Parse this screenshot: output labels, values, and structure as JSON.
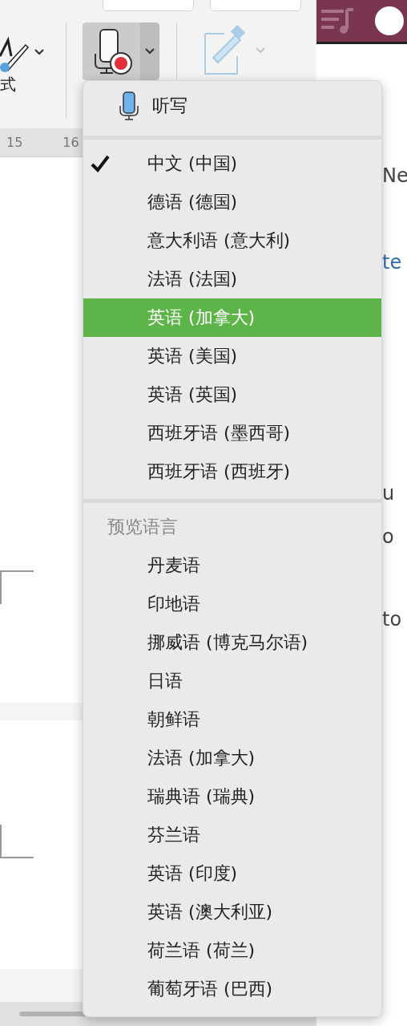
{
  "toolbar": {
    "styles_label": "式"
  },
  "ruler": {
    "marks": [
      "15",
      "16"
    ]
  },
  "side_panel": {
    "texts": [
      {
        "text": "Ne",
        "kind": "text"
      },
      {
        "text": "te",
        "kind": "link"
      },
      {
        "text": "u",
        "kind": "text"
      },
      {
        "text": "o",
        "kind": "text"
      },
      {
        "text": "to",
        "kind": "text"
      }
    ]
  },
  "menu": {
    "header": {
      "label": "听写"
    },
    "languages": [
      {
        "label": "中文 (中国)",
        "checked": true,
        "selected": false
      },
      {
        "label": "德语 (德国)",
        "checked": false,
        "selected": false
      },
      {
        "label": "意大利语 (意大利)",
        "checked": false,
        "selected": false
      },
      {
        "label": "法语 (法国)",
        "checked": false,
        "selected": false
      },
      {
        "label": "英语 (加拿大)",
        "checked": false,
        "selected": true
      },
      {
        "label": "英语 (美国)",
        "checked": false,
        "selected": false
      },
      {
        "label": "英语 (英国)",
        "checked": false,
        "selected": false
      },
      {
        "label": "西班牙语 (墨西哥)",
        "checked": false,
        "selected": false
      },
      {
        "label": "西班牙语 (西班牙)",
        "checked": false,
        "selected": false
      }
    ],
    "preview_section": {
      "title": "预览语言",
      "items": [
        {
          "label": "丹麦语",
          "selected": false
        },
        {
          "label": "印地语",
          "selected": false
        },
        {
          "label": "挪威语 (博克马尔语)",
          "selected": false
        },
        {
          "label": "日语",
          "selected": false
        },
        {
          "label": "朝鲜语",
          "selected": false
        },
        {
          "label": "法语 (加拿大)",
          "selected": false
        },
        {
          "label": "瑞典语 (瑞典)",
          "selected": false
        },
        {
          "label": "芬兰语",
          "selected": false
        },
        {
          "label": "英语 (印度)",
          "selected": false
        },
        {
          "label": "英语 (澳大利亚)",
          "selected": false
        },
        {
          "label": "荷兰语 (荷兰)",
          "selected": false
        },
        {
          "label": "葡萄牙语 (巴西)",
          "selected": false
        }
      ]
    }
  }
}
